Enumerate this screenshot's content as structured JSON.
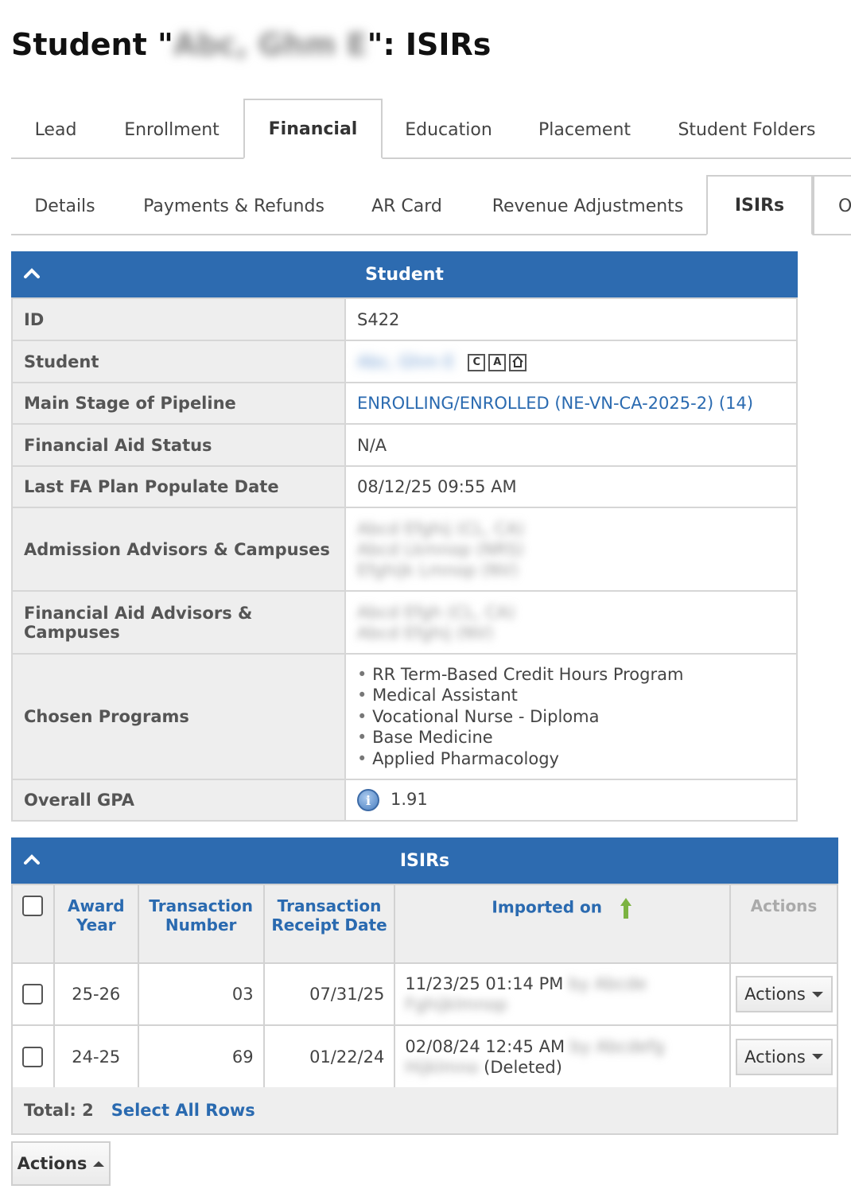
{
  "page": {
    "title_prefix": "Student \"",
    "title_name": "Abc, Ghm E",
    "title_suffix": "\": ISIRs"
  },
  "tabs_primary": [
    "Lead",
    "Enrollment",
    "Financial",
    "Education",
    "Placement",
    "Student Folders"
  ],
  "tabs_secondary": [
    "Details",
    "Payments & Refunds",
    "AR Card",
    "Revenue Adjustments",
    "ISIRs",
    "O"
  ],
  "student_panel": {
    "header": "Student",
    "rows": {
      "id": {
        "label": "ID",
        "value": "S422"
      },
      "student": {
        "label": "Student",
        "value": "Abc, Ghm E",
        "icons": [
          "C",
          "A",
          "home"
        ]
      },
      "pipeline": {
        "label": "Main Stage of Pipeline",
        "value": "ENROLLING/ENROLLED (NE-VN-CA-2025-2) (14)"
      },
      "fa_status": {
        "label": "Financial Aid Status",
        "value": "N/A"
      },
      "fa_plan_date": {
        "label": "Last FA Plan Populate Date",
        "value": "08/12/25 09:55 AM"
      },
      "admission_advisors": {
        "label": "Admission Advisors & Campuses",
        "lines": [
          "Abcd Efghij (CL, CA)",
          "Abcd Lkmnop (NRS)",
          "Efghijk Lmnop (NV)"
        ]
      },
      "fa_advisors": {
        "label": "Financial Aid Advisors & Campuses",
        "lines": [
          "Abcd Efgh (CL, CA)",
          "Abcd Efghij (NV)"
        ]
      },
      "programs": {
        "label": "Chosen Programs",
        "items": [
          "RR Term-Based Credit Hours Program",
          "Medical Assistant",
          "Vocational Nurse - Diploma",
          "Base Medicine",
          "Applied Pharmacology"
        ]
      },
      "gpa": {
        "label": "Overall GPA",
        "value": "1.91"
      }
    }
  },
  "isir_panel": {
    "header": "ISIRs",
    "columns": {
      "award_year": "Award Year",
      "transaction_number": "Transaction Number",
      "receipt_date": "Transaction Receipt Date",
      "imported_on": "Imported on",
      "actions": "Actions"
    },
    "rows": [
      {
        "award_year": "25-26",
        "transaction_number": "03",
        "receipt_date": "07/31/25",
        "imported_on": "11/23/25 01:14 PM",
        "imported_by": "by Abcde Fghijklmnop",
        "deleted": "",
        "action_label": "Actions"
      },
      {
        "award_year": "24-25",
        "transaction_number": "69",
        "receipt_date": "01/22/24",
        "imported_on": "02/08/24 12:45 AM",
        "imported_by": "by Abcdefg Hijklmno",
        "deleted": "(Deleted)",
        "action_label": "Actions"
      }
    ],
    "total_label": "Total: 2",
    "select_all": "Select All Rows"
  },
  "bottom_actions_label": "Actions",
  "colors": {
    "header_blue": "#2d6bb0",
    "link_blue": "#2a6ab0",
    "sort_arrow_green": "#7cb342"
  }
}
